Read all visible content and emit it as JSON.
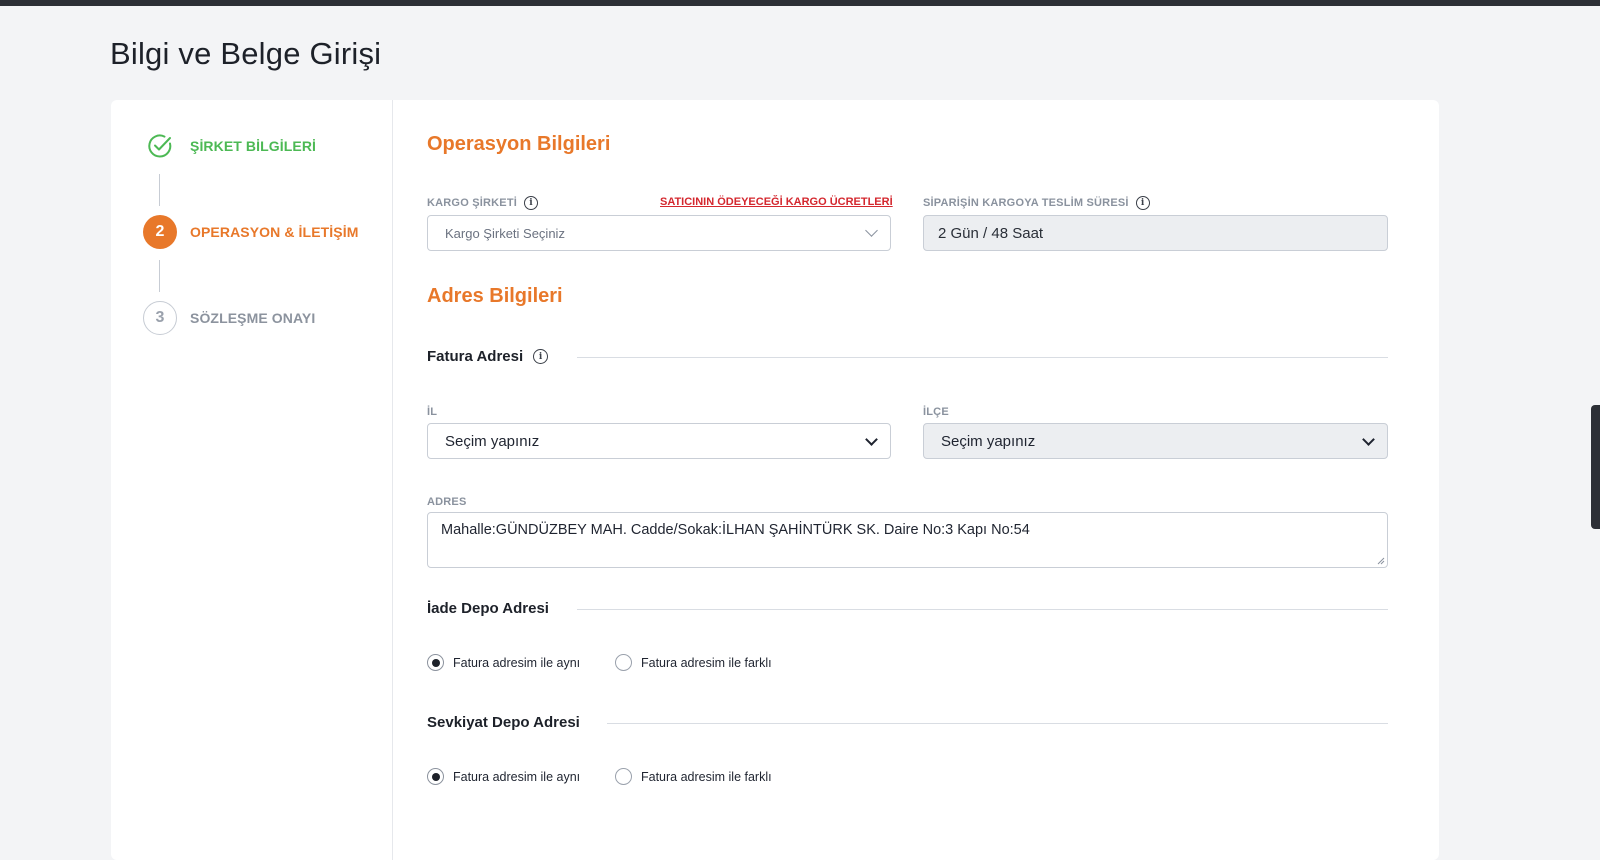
{
  "page": {
    "title": "Bilgi ve Belge Girişi"
  },
  "steps": [
    {
      "badge": "",
      "label": "ŞİRKET BİLGİLERİ",
      "state": "done"
    },
    {
      "badge": "2",
      "label": "OPERASYON & İLETİŞİM",
      "state": "active"
    },
    {
      "badge": "3",
      "label": "SÖZLEŞME ONAYI",
      "state": "pending"
    }
  ],
  "operation": {
    "title": "Operasyon Bilgileri",
    "cargo_label": "KARGO ŞİRKETİ",
    "cargo_fees_link": "SATICININ ÖDEYECEĞİ KARGO ÜCRETLERİ",
    "cargo_placeholder": "Kargo Şirketi Seçiniz",
    "delivery_label": "SİPARİŞİN KARGOYA TESLİM SÜRESİ",
    "delivery_value": "2 Gün / 48 Saat"
  },
  "address": {
    "title": "Adres Bilgileri",
    "invoice_heading": "Fatura Adresi",
    "il_label": "İL",
    "il_value": "Seçim yapınız",
    "ilce_label": "İLÇE",
    "ilce_value": "Seçim yapınız",
    "adres_label": "ADRES",
    "adres_value": "Mahalle:GÜNDÜZBEY MAH. Cadde/Sokak:İLHAN ŞAHİNTÜRK SK. Daire No:3 Kapı No:54",
    "return_heading": "İade Depo Adresi",
    "shipping_heading": "Sevkiyat Depo Adresi",
    "option_same": "Fatura adresim ile aynı",
    "option_diff": "Fatura adresim ile farklı"
  },
  "colors": {
    "accent": "#e8782a",
    "success": "#4cb954",
    "link": "#d4272e"
  }
}
